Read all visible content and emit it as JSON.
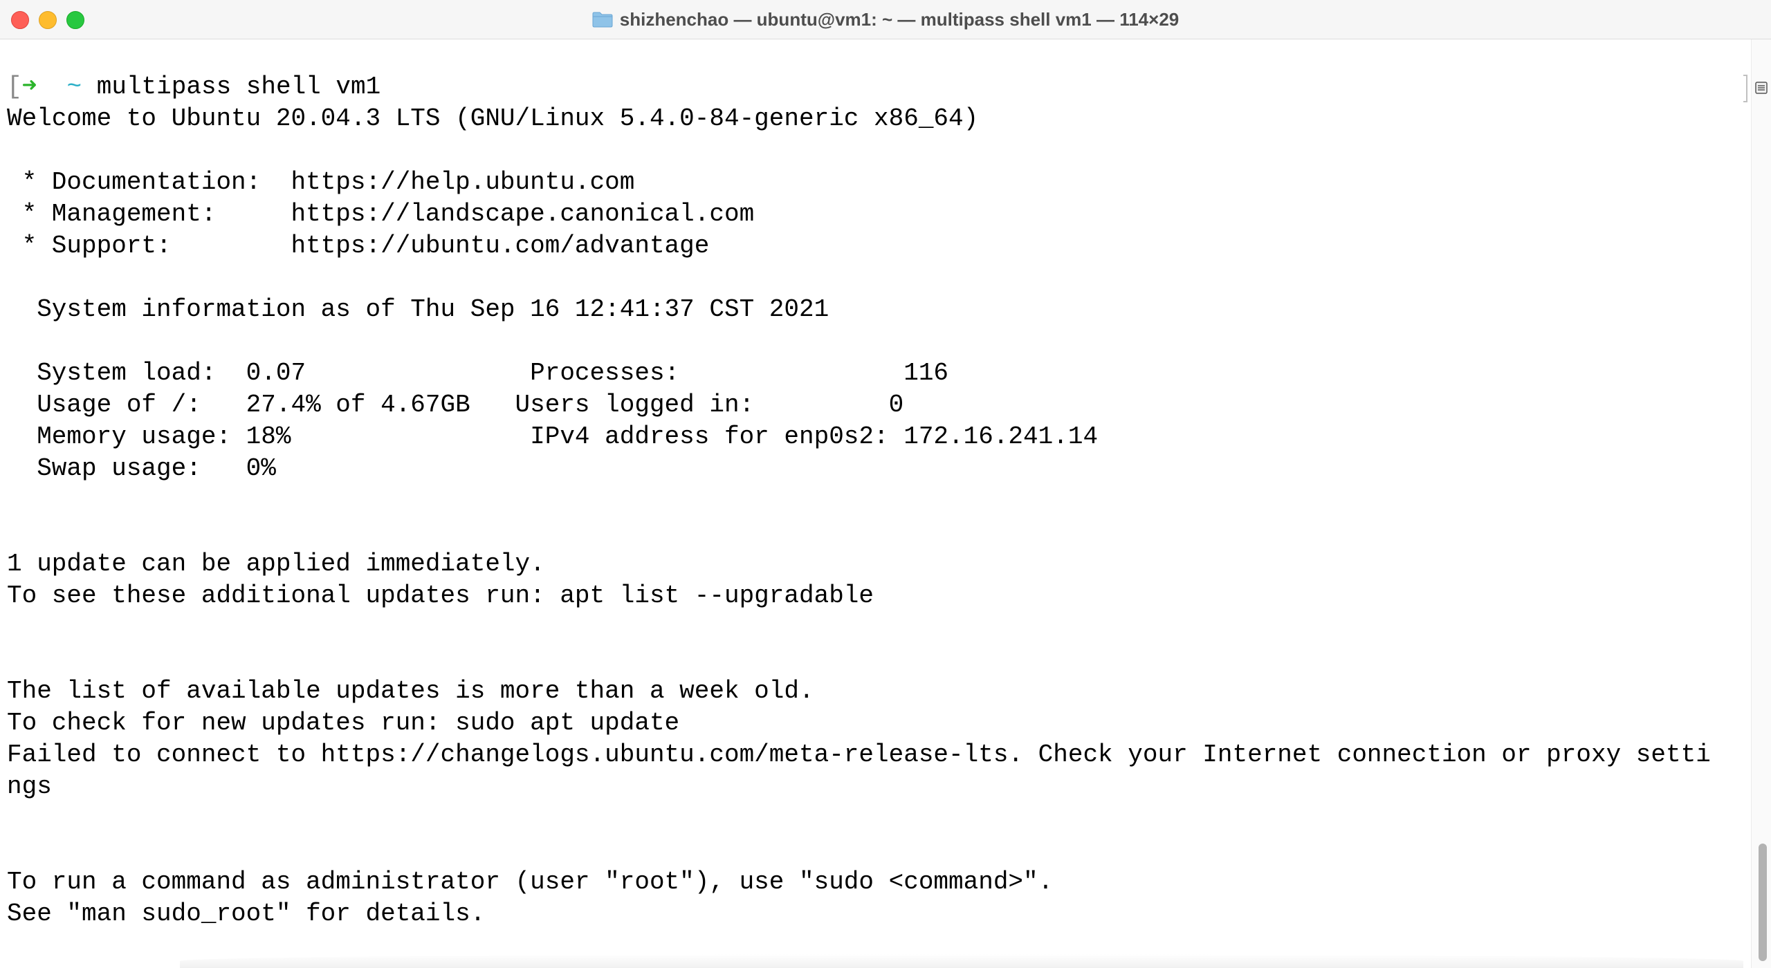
{
  "window": {
    "title": "shizhenchao — ubuntu@vm1: ~ — multipass shell vm1 — 114×29",
    "folder_icon": "folder-icon"
  },
  "prompt": {
    "bracket": "[",
    "arrow": "➜",
    "cwd": "~",
    "command": "multipass shell vm1"
  },
  "output": {
    "welcome": "Welcome to Ubuntu 20.04.3 LTS (GNU/Linux 5.4.0-84-generic x86_64)",
    "doc_line": " * Documentation:  https://help.ubuntu.com",
    "mgmt_line": " * Management:     https://landscape.canonical.com",
    "support_line": " * Support:        https://ubuntu.com/advantage",
    "sysinfo_header": "  System information as of Thu Sep 16 12:41:37 CST 2021",
    "sys_load_line": "  System load:  0.07               Processes:               116",
    "usage_line": "  Usage of /:   27.4% of 4.67GB   Users logged in:         0",
    "memory_line": "  Memory usage: 18%                IPv4 address for enp0s2: 172.16.241.14",
    "swap_line": "  Swap usage:   0%",
    "update_line1": "1 update can be applied immediately.",
    "update_line2": "To see these additional updates run: apt list --upgradable",
    "stale_line1": "The list of available updates is more than a week old.",
    "stale_line2": "To check for new updates run: sudo apt update",
    "failed_line1": "Failed to connect to https://changelogs.ubuntu.com/meta-release-lts. Check your Internet connection or proxy setti",
    "failed_line2": "ngs",
    "admin_line1": "To run a command as administrator (user \"root\"), use \"sudo <command>\".",
    "admin_line2": "See \"man sudo_root\" for details."
  },
  "colors": {
    "prompt_arrow": "#2bb42b",
    "prompt_cwd": "#2bafc7",
    "close": "#fe5f57",
    "minimize": "#febc2e",
    "zoom": "#28c840"
  }
}
